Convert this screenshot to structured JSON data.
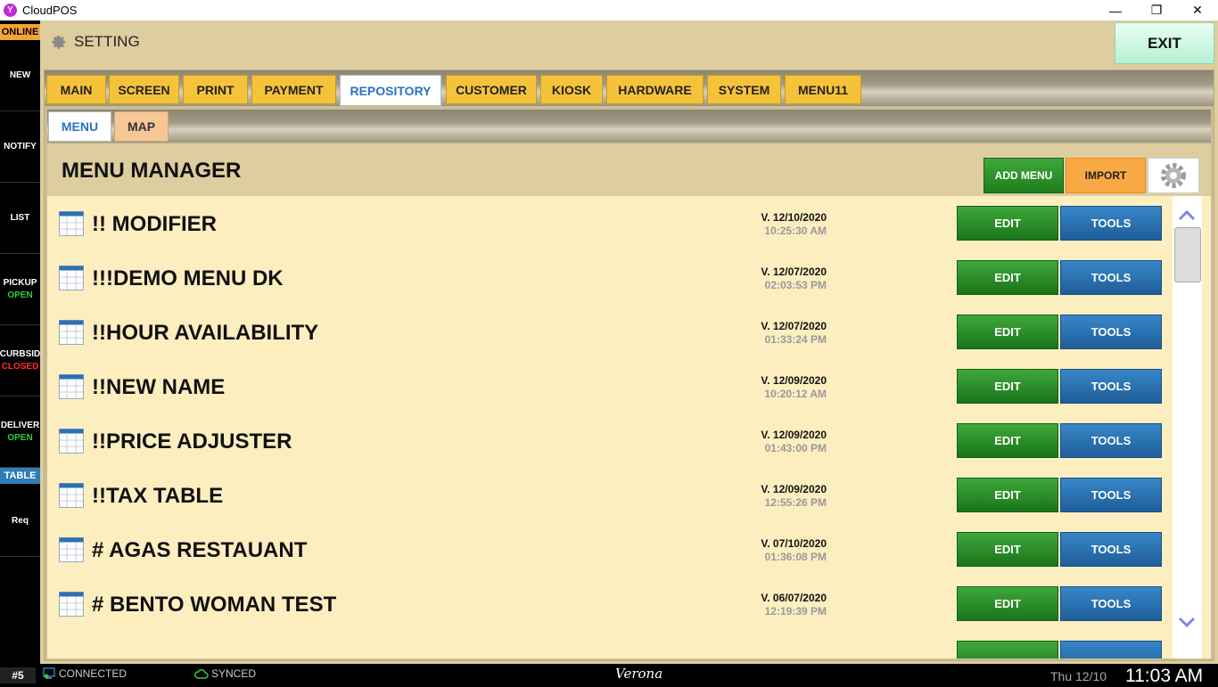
{
  "window": {
    "title": "CloudPOS",
    "logo_letter": "Y"
  },
  "rail": {
    "status": "ONLINE",
    "items": [
      {
        "label": "NEW",
        "sub": ""
      },
      {
        "label": "NOTIFY",
        "sub": ""
      },
      {
        "label": "LIST",
        "sub": ""
      },
      {
        "label": "PICKUP",
        "sub": "OPEN",
        "sub_color": "#2ecc40"
      },
      {
        "label": "CURBSID",
        "sub": "CLOSED",
        "sub_color": "#ff2b2b"
      },
      {
        "label": "DELIVER",
        "sub": "OPEN",
        "sub_color": "#2ecc40"
      }
    ],
    "table": "TABLE",
    "req": "Req"
  },
  "header": {
    "title": "SETTING",
    "exit_label": "EXIT"
  },
  "tabs": [
    "MAIN",
    "SCREEN",
    "PRINT",
    "PAYMENT",
    "REPOSITORY",
    "CUSTOMER",
    "KIOSK",
    "HARDWARE",
    "SYSTEM",
    "MENU11"
  ],
  "active_tab": "REPOSITORY",
  "subtabs": [
    "MENU",
    "MAP"
  ],
  "menu_manager": {
    "title": "MENU MANAGER",
    "add_menu_label": "ADD MENU",
    "import_label": "IMPORT",
    "edit_label": "EDIT",
    "tools_label": "TOOLS",
    "rows": [
      {
        "name": "!! MODIFIER",
        "version": "V. 12/10/2020",
        "time": "10:25:30 AM"
      },
      {
        "name": "!!!DEMO MENU DK",
        "version": "V. 12/07/2020",
        "time": "02:03:53 PM"
      },
      {
        "name": "!!HOUR AVAILABILITY",
        "version": "V. 12/07/2020",
        "time": "01:33:24 PM"
      },
      {
        "name": "!!NEW NAME",
        "version": "V. 12/09/2020",
        "time": "10:20:12 AM"
      },
      {
        "name": "!!PRICE ADJUSTER",
        "version": "V. 12/09/2020",
        "time": "01:43:00 PM"
      },
      {
        "name": "!!TAX TABLE",
        "version": "V. 12/09/2020",
        "time": "12:55:26 PM"
      },
      {
        "name": "# AGAS RESTAUANT",
        "version": "V. 07/10/2020",
        "time": "01:36:08 PM"
      },
      {
        "name": "# BENTO WOMAN TEST",
        "version": "V. 06/07/2020",
        "time": "12:19:39 PM"
      }
    ]
  },
  "statusbar": {
    "station": "#5",
    "connected": "CONNECTED",
    "synced": "SYNCED",
    "location": "Verona",
    "date": "Thu 12/10",
    "time": "11:03 AM"
  },
  "colors": {
    "online": "#f5a23a",
    "table": "#2e7db8",
    "edit": "#2a8f27",
    "tools": "#2a6fae",
    "import": "#f9a944"
  }
}
